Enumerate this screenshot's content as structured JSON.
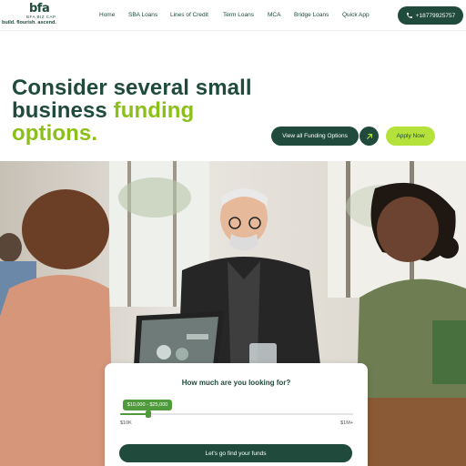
{
  "header": {
    "logo": {
      "mark": "bfa",
      "subtitle": "BFA BIZ CAP",
      "tagline": "build. flourish. ascend."
    },
    "nav": [
      {
        "label": "Home"
      },
      {
        "label": "SBA Loans"
      },
      {
        "label": "Lines of Credit"
      },
      {
        "label": "Term Loans"
      },
      {
        "label": "MCA"
      },
      {
        "label": "Bridge Loans"
      },
      {
        "label": "Quick App"
      }
    ],
    "phone": "+18779925757"
  },
  "hero": {
    "title_line1": "Consider several small",
    "title_line2_plain": "business ",
    "title_line2_accent": "funding",
    "title_line3_accent": "options.",
    "view_options_label": "View all Funding Options",
    "apply_label": "Apply Now"
  },
  "form": {
    "question": "How much are you looking for?",
    "selected_range": "$10,000 - $25,000",
    "slider_position": 0.12,
    "min_label": "$10K",
    "max_label": "$1M+",
    "submit_label": "Let's go find your funds"
  },
  "colors": {
    "brand_dark": "#1f4a3c",
    "brand_lime": "#b5e23a",
    "accent_green": "#8dbf1a",
    "slider_green": "#4f9a3a"
  },
  "icons": [
    "phone-icon",
    "arrow-up-right-icon"
  ]
}
